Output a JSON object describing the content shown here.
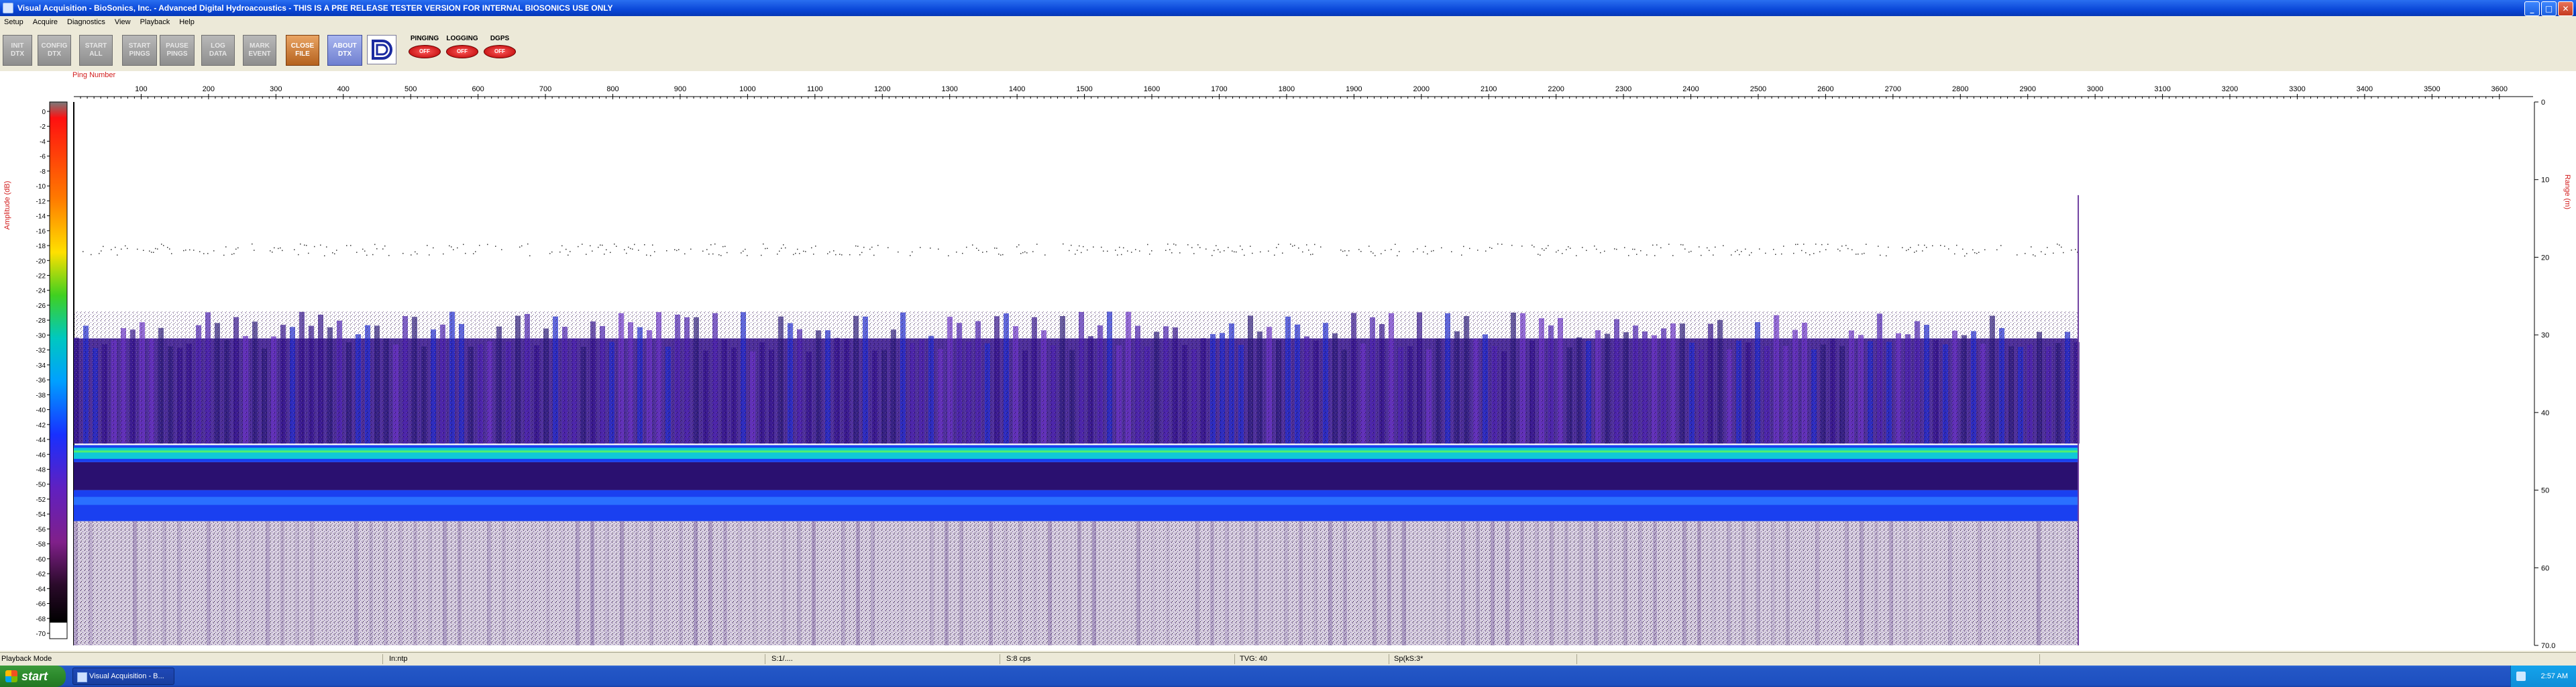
{
  "window": {
    "title": "Visual Acquisition  -  BioSonics, Inc.   -   Advanced Digital Hydroacoustics   -   THIS IS A PRE RELEASE TESTER VERSION FOR INTERNAL BIOSONICS USE ONLY",
    "minimize_glyph": "_",
    "maximize_glyph": "□",
    "close_glyph": "✕"
  },
  "menu": [
    "Setup",
    "Acquire",
    "Diagnostics",
    "View",
    "Playback",
    "Help"
  ],
  "toolbar": {
    "buttons": [
      {
        "label": "INIT\nDTX",
        "style": "gray"
      },
      {
        "label": "CONFIG\nDTX",
        "style": "gray"
      },
      {
        "label": "START\nALL",
        "style": "gray"
      },
      {
        "label": "START\nPINGS",
        "style": "gray"
      },
      {
        "label": "PAUSE\nPINGS",
        "style": "gray"
      },
      {
        "label": "LOG\nDATA",
        "style": "gray"
      },
      {
        "label": "MARK\nEVENT",
        "style": "gray"
      },
      {
        "label": "CLOSE\nFILE",
        "style": "orange"
      },
      {
        "label": "ABOUT\nDTX",
        "style": "blue"
      }
    ],
    "indicators": [
      {
        "label": "PINGING",
        "state": "OFF"
      },
      {
        "label": "LOGGING",
        "state": "OFF"
      },
      {
        "label": "DGPS",
        "state": "OFF"
      }
    ],
    "logo_text": "B"
  },
  "echogram": {
    "x_axis_title": "Ping Number",
    "x_ticks": [
      100,
      200,
      300,
      400,
      500,
      600,
      700,
      800,
      900,
      1000,
      1100,
      1200,
      1300,
      1400,
      1500,
      1600,
      1700,
      1800,
      1900,
      2000,
      2100,
      2200,
      2300,
      2400,
      2500,
      2600,
      2700,
      2800,
      2900,
      3000,
      3100,
      3200,
      3300,
      3400,
      3500,
      3600
    ],
    "x_range": [
      0,
      3650
    ],
    "data_end_ping": 2975,
    "amplitude_label": "Amplitude (dB)",
    "amplitude_ticks": [
      0,
      -2,
      -4,
      -6,
      -8,
      -10,
      -12,
      -14,
      -16,
      -18,
      -20,
      -22,
      -24,
      -26,
      -28,
      -30,
      -32,
      -34,
      -36,
      -38,
      -40,
      -42,
      -44,
      -46,
      -48,
      -50,
      -52,
      -54,
      -56,
      -58,
      -60,
      -62,
      -64,
      -66,
      -68,
      -70
    ],
    "range_label": "Range (m)",
    "range_ticks": [
      "0",
      "10",
      "20",
      "30",
      "40",
      "50",
      "60",
      "70.0"
    ],
    "range_max": 70,
    "colors": {
      "bottom_band": "#10c8d8",
      "second_band": "#1a40f0",
      "noise": "#4a1aa8"
    }
  },
  "status": {
    "mode": "Playback Mode",
    "fields": [
      "In:ntp",
      "S:1/....",
      "S:8 cps",
      "TVG: 40",
      "Sp(kS:3*"
    ]
  },
  "taskbar": {
    "start_label": "start",
    "task_item": "Visual Acquisition - B...",
    "clock": "2:57 AM"
  }
}
